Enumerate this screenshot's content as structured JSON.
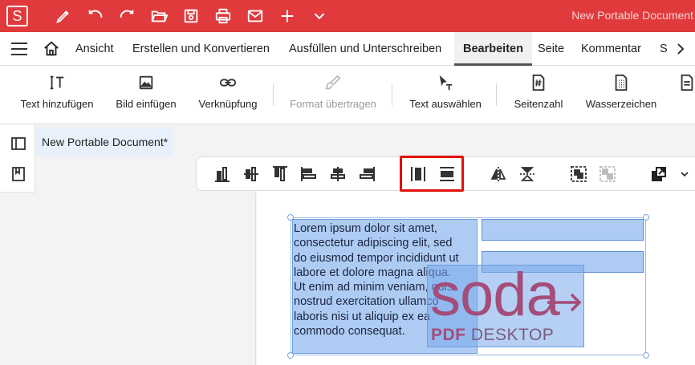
{
  "app": {
    "logo_letter": "S",
    "document_title": "New Portable Document",
    "accent_color": "#e03a3c"
  },
  "quick_access": [
    "pen-icon",
    "undo-icon",
    "redo-icon",
    "open-folder-icon",
    "save-icon",
    "print-icon",
    "mail-icon",
    "plus-icon",
    "chevron-down-icon"
  ],
  "menu": {
    "tabs": [
      {
        "label": "Ansicht"
      },
      {
        "label": "Erstellen und Konvertieren"
      },
      {
        "label": "Ausfüllen und Unterschreiben"
      },
      {
        "label": "Bearbeiten",
        "active": true
      },
      {
        "label": "Seite"
      },
      {
        "label": "Kommentar"
      },
      {
        "label": "S"
      }
    ]
  },
  "ribbon": {
    "add_text": "Text hinzufügen",
    "add_image": "Bild einfügen",
    "link": "Verknüpfung",
    "format_painter": "Format übertragen",
    "select_text": "Text auswählen",
    "page_number": "Seitenzahl",
    "watermark": "Wasserzeichen"
  },
  "document_tab": {
    "label": "New Portable Document*"
  },
  "page_content": {
    "lorem_lines": [
      "Lorem ipsum dolor sit amet,",
      "consectetur adipiscing elit, sed",
      "do eiusmod tempor incididunt ut",
      "labore et dolore magna aliqua.",
      "Ut enim ad minim veniam, quis",
      "nostrud exercitation ullamco",
      "laboris nisi ut aliquip ex ea",
      "commodo consequat."
    ],
    "logo_word": "soda",
    "logo_sub_bold": "PDF",
    "logo_sub": " DESKTOP",
    "logo_color": "#a44d7a"
  }
}
